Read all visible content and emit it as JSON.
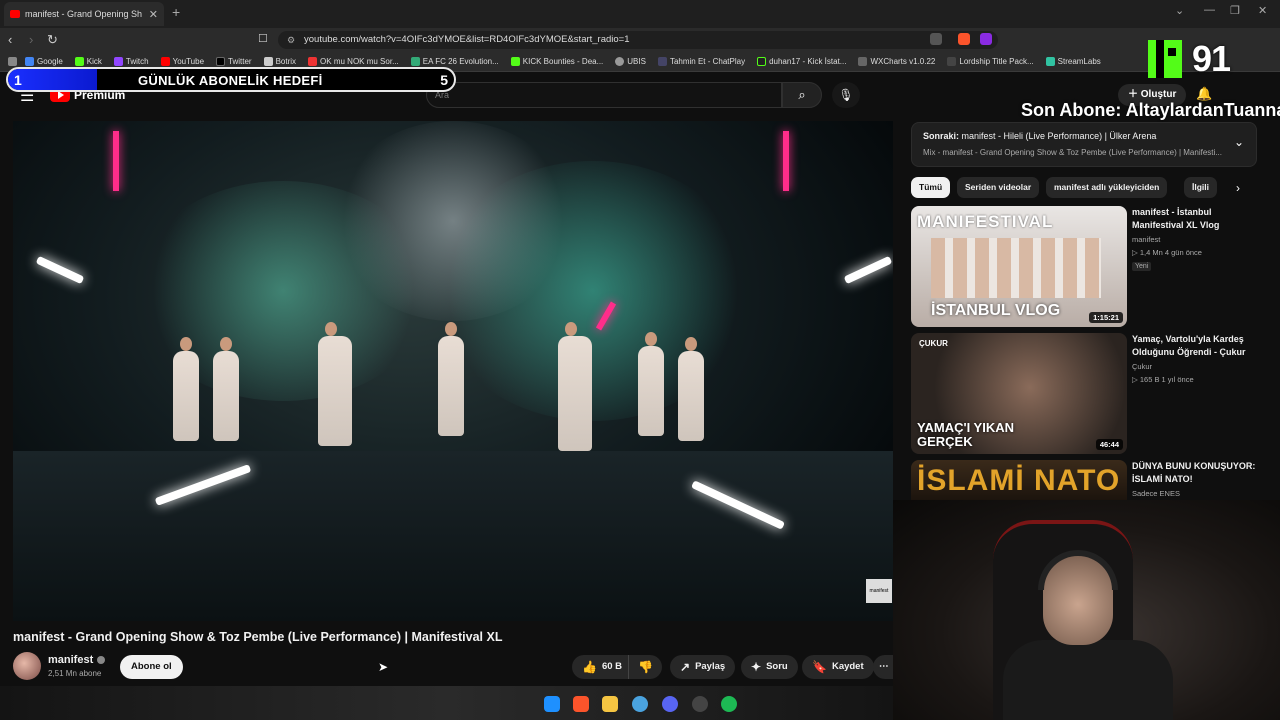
{
  "browser": {
    "tab_title": "manifest - Grand Opening Sh",
    "url": "youtube.com/watch?v=4OIFc3dYMOE&list=RD4OIFc3dYMOE&start_radio=1",
    "bookmarks": [
      "Google",
      "Kick",
      "Twitch",
      "YouTube",
      "Twitter",
      "Botrix",
      "OK mu NOK mu Sor...",
      "EA FC 26 Evolution...",
      "KICK Bounties - Dea...",
      "UBIS",
      "Tahmin Et - ChatPlay",
      "duhan17 - Kick İstat...",
      "WXCharts v1.0.22",
      "Lordship Title Pack...",
      "StreamLabs"
    ]
  },
  "overlay": {
    "goal_current": "1",
    "goal_label": "GÜNLÜK ABONELİK HEDEFİ",
    "goal_target": "5",
    "goal_progress": 0.2,
    "viewer_count": "91",
    "last_sub": "Son Abone: AltaylardanTuannay"
  },
  "youtube": {
    "logo_text": "Premium",
    "logo_region": "TR",
    "search_placeholder": "Ara",
    "create_label": "Oluştur",
    "video_title": "manifest - Grand Opening Show & Toz Pembe (Live Performance) | Manifestival XL",
    "watermark": "manifest",
    "channel_name": "manifest",
    "subscribers": "2,51 Mn abone",
    "subscribe_label": "Abone ol",
    "likes": "60 B",
    "share_label": "Paylaş",
    "ask_label": "Soru",
    "save_label": "Kaydet"
  },
  "sidebar": {
    "next_prefix": "Sonraki:",
    "next_title": "manifest - Hileli (Live Performance) | Ülker Arena",
    "next_sub": "Mix - manifest - Grand Opening Show & Toz Pembe (Live Performance) | Manifesti...",
    "chips": [
      "Tümü",
      "Seriden videolar",
      "manifest adlı yükleyiciden",
      "İlgili"
    ],
    "videos": [
      {
        "title": "manifest - İstanbul Manifestival XL Vlog",
        "channel": "manifest",
        "meta": "▷ 1,4 Mn  4 gün önce",
        "badge": "Yeni",
        "duration": "1:15:21",
        "thumb_text": "İSTANBUL VLOG",
        "thumb_brand": "MANIFESTIVAL"
      },
      {
        "title": "Yamaç, Vartolu'yla Kardeş Olduğunu Öğrendi - Çukur",
        "channel": "Çukur",
        "meta": "▷ 165 B  1 yıl önce",
        "duration": "46:44",
        "thumb_text": "YAMAÇ'I YIKAN GERÇEK",
        "thumb_brand": "ÇUKUR"
      },
      {
        "title": "DÜNYA BUNU KONUŞUYOR: İSLAMİ NATO!",
        "channel": "Sadece ENES",
        "thumb_text": "İSLAMİ NATO"
      }
    ]
  },
  "colors": {
    "accent": "#ff0000",
    "kick_green": "#53fc18",
    "goal_fill": "#1a2fff"
  }
}
